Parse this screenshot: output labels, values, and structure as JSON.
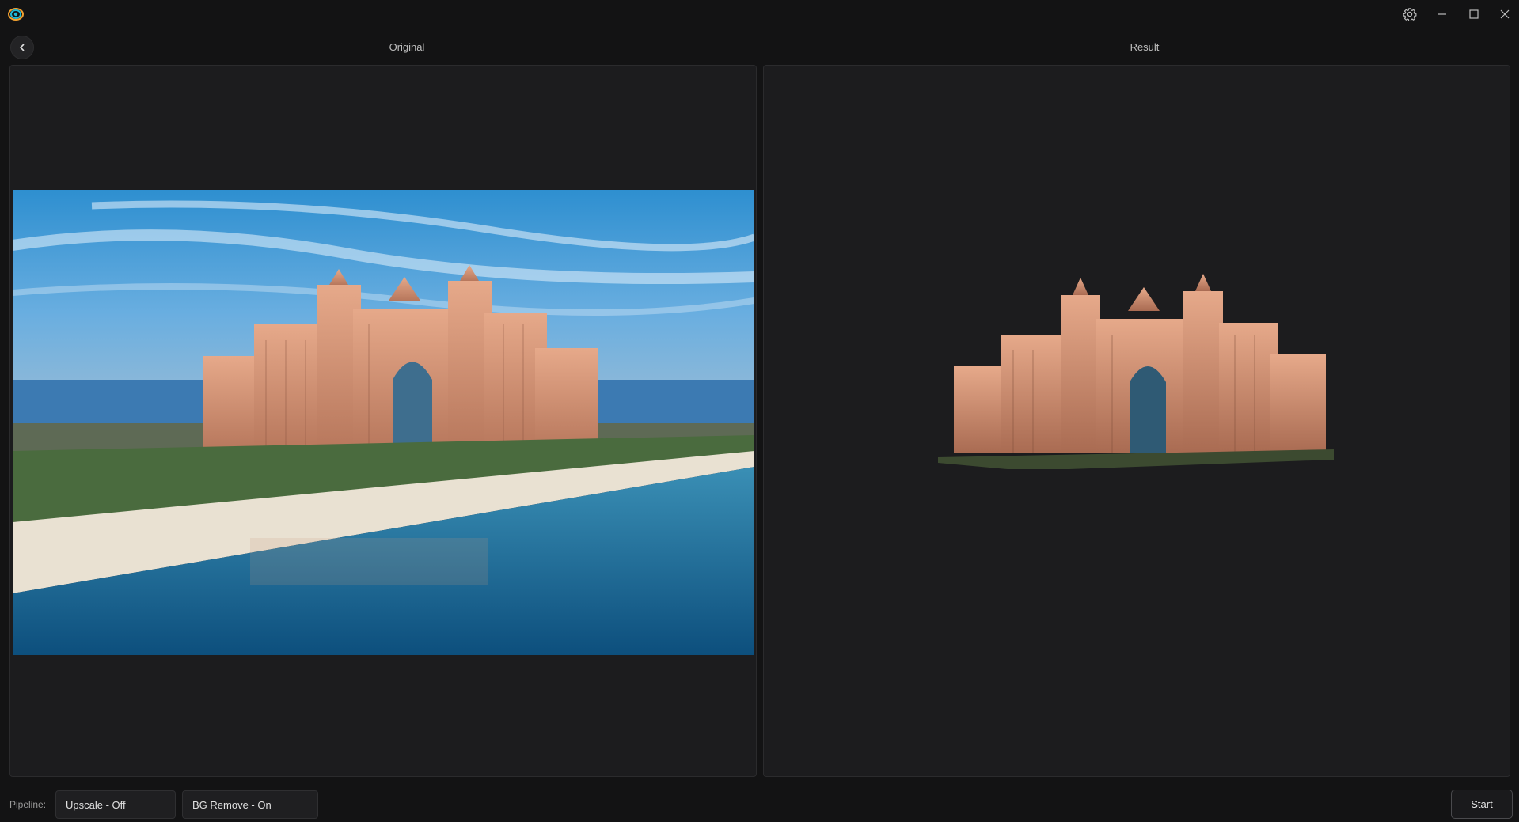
{
  "window": {
    "title_icons": [
      "app-logo-icon",
      "settings-gear-icon",
      "minimize-icon",
      "maximize-icon",
      "close-icon"
    ]
  },
  "header": {
    "back_icon": "chevron-left-icon",
    "original_label": "Original",
    "result_label": "Result"
  },
  "panes": {
    "original": {
      "content": "photo of Atlantis resort with beach and sea"
    },
    "result": {
      "content": "resort building with background removed"
    }
  },
  "pipeline": {
    "label": "Pipeline:",
    "upscale": "Upscale - Off",
    "bg_remove": "BG Remove - On"
  },
  "actions": {
    "start": "Start"
  },
  "colors": {
    "background": "#131314",
    "pane": "#1c1c1e",
    "border": "#2b2b2d",
    "accent_logo_cyan": "#1fb7d6",
    "accent_logo_orange": "#f0a030"
  }
}
